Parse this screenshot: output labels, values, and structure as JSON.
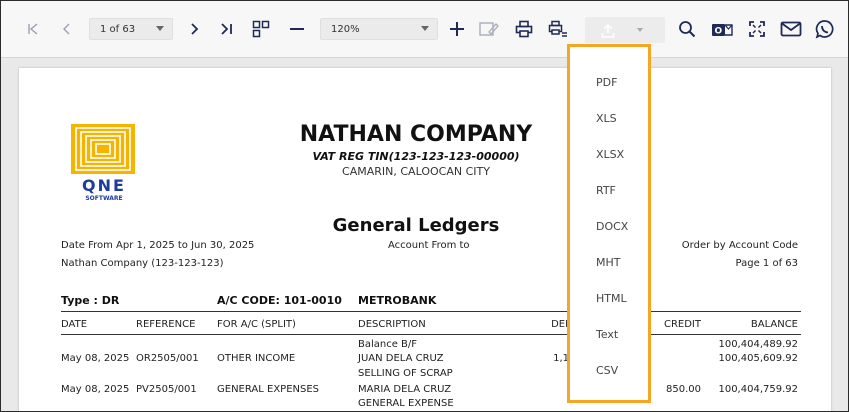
{
  "toolbar": {
    "page_indicator": "1 of 63",
    "zoom": "120%"
  },
  "export_menu": {
    "items": [
      "PDF",
      "XLS",
      "XLSX",
      "RTF",
      "DOCX",
      "MHT",
      "HTML",
      "Text",
      "CSV"
    ]
  },
  "report": {
    "logo_text": "QNE",
    "logo_sub": "SOFTWARE",
    "company": "NATHAN COMPANY",
    "vat": "VAT REG TIN(123-123-123-00000)",
    "address": "CAMARIN, CALOOCAN CITY",
    "title": "General Ledgers",
    "date_range": "Date From Apr 1, 2025 to Jun 30, 2025",
    "account_from": "Account From  to",
    "order_by": "Order by Account Code",
    "company_line": "Nathan Company (123-123-123)",
    "page_info": "Page 1 of 63",
    "type": "Type : DR",
    "ac_code": "A/C CODE: 101-0010",
    "ac_name": "METROBANK",
    "columns": {
      "date": "DATE",
      "reference": "REFERENCE",
      "for_ac": "FOR A/C (SPLIT)",
      "description": "DESCRIPTION",
      "debit": "DEBIT",
      "credit": "CREDIT",
      "balance": "BALANCE"
    },
    "rows": [
      {
        "date": "",
        "reference": "",
        "for_ac": "",
        "description": "Balance B/F",
        "debit": "",
        "credit": "",
        "balance": "100,404,489.92"
      },
      {
        "date": "May 08, 2025",
        "reference": "OR2505/001",
        "for_ac": "OTHER INCOME",
        "description": "JUAN DELA CRUZ",
        "debit": "1,1",
        "credit": "",
        "balance": "100,405,609.92"
      },
      {
        "date": "",
        "reference": "",
        "for_ac": "",
        "description": "SELLING OF SCRAP",
        "debit": "",
        "credit": "",
        "balance": ""
      },
      {
        "date": "May 08, 2025",
        "reference": "PV2505/001",
        "for_ac": "GENERAL EXPENSES",
        "description": "MARIA DELA CRUZ",
        "debit": "",
        "credit": "850.00",
        "balance": "100,404,759.92"
      },
      {
        "date": "",
        "reference": "",
        "for_ac": "",
        "description": "GENERAL EXPENSE",
        "debit": "",
        "credit": "",
        "balance": ""
      }
    ]
  }
}
